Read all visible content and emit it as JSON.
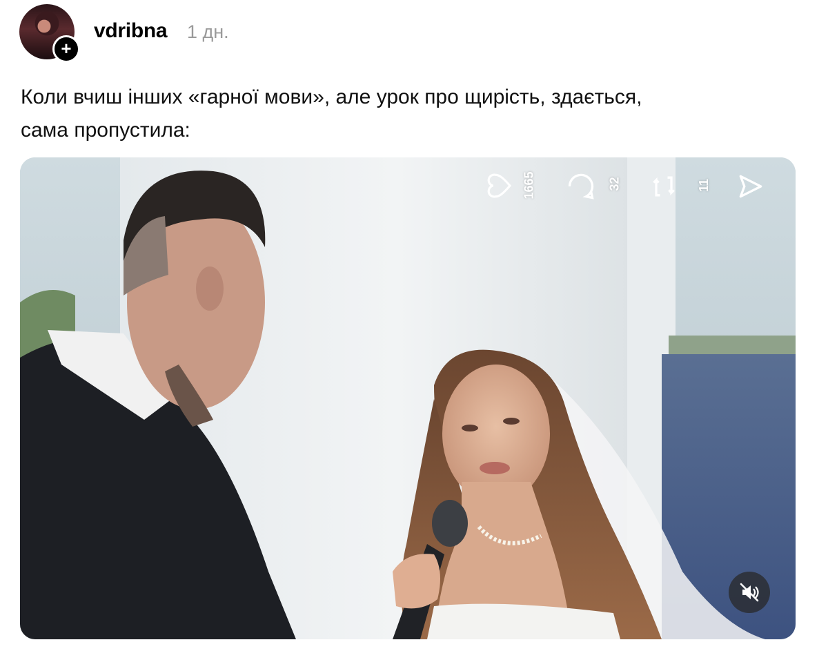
{
  "post": {
    "username": "vdribna",
    "timestamp": "1 дн.",
    "caption_line1": "Коли вчиш інших «гарної мови», але урок про щирість, здається,",
    "caption_line2": "сама пропустила:",
    "follow_icon": "plus-icon"
  },
  "video_overlay": {
    "likes": "1665",
    "comments": "32",
    "reposts": "11",
    "icons": [
      "heart-icon",
      "comment-icon",
      "repost-icon",
      "send-icon"
    ]
  },
  "video": {
    "muted": true,
    "mute_icon": "speaker-muted-icon"
  }
}
